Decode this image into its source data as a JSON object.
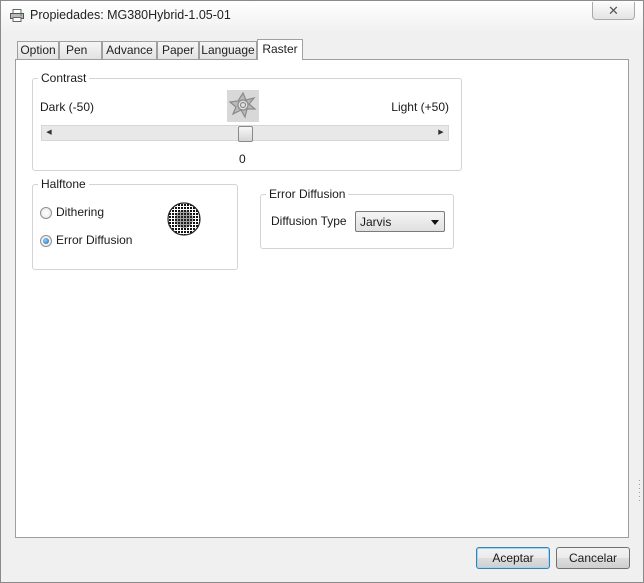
{
  "window": {
    "title": "Propiedades: MG380Hybrid-1.05-01",
    "close_icon": "✕"
  },
  "tabs": [
    {
      "label": "Option"
    },
    {
      "label": "Pen"
    },
    {
      "label": "Advance"
    },
    {
      "label": "Paper"
    },
    {
      "label": "Language"
    },
    {
      "label": "Raster"
    }
  ],
  "active_tab": "Raster",
  "contrast": {
    "group_label": "Contrast",
    "dark_label": "Dark (-50)",
    "light_label": "Light (+50)",
    "value": "0",
    "min": -50,
    "max": 50,
    "current": 0,
    "icon": "contrast-preview-icon"
  },
  "halftone": {
    "group_label": "Halftone",
    "options": [
      {
        "label": "Dithering",
        "checked": false
      },
      {
        "label": "Error Diffusion",
        "checked": true
      }
    ],
    "icon": "halftone-preview-icon"
  },
  "error_diffusion": {
    "group_label": "Error Diffusion",
    "diffusion_type_label": "Diffusion Type",
    "diffusion_type_value": "Jarvis"
  },
  "buttons": {
    "accept": "Aceptar",
    "cancel": "Cancelar"
  },
  "colors": {
    "accent": "#3c7fb1",
    "panel": "#ffffff",
    "chrome": "#f0f0f0"
  }
}
